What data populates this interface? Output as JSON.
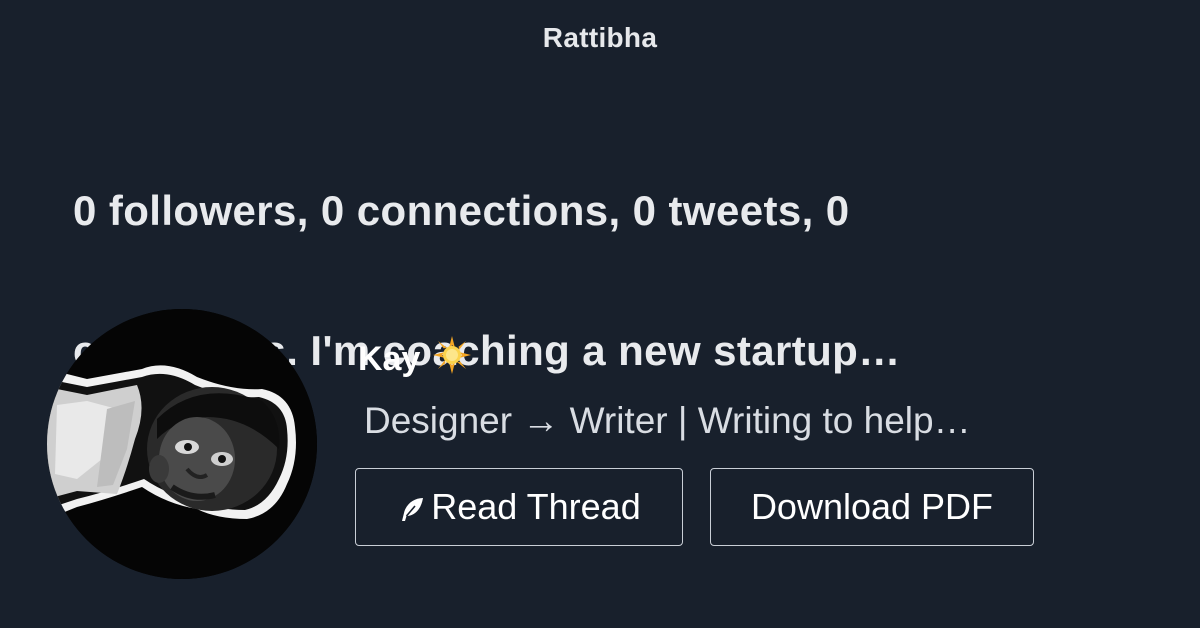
{
  "brand": {
    "name": "Rattibha"
  },
  "thread": {
    "headline_line1": "0 followers, 0 connections, 0 tweets, 0",
    "headline_line2": "comments. I'm coaching a new startup…"
  },
  "author": {
    "name": "Kay",
    "badge_emoji": "🌟",
    "bio": "Designer → Writer | Writing to help…"
  },
  "actions": {
    "read_thread_label": "Read Thread",
    "download_pdf_label": "Download PDF"
  },
  "colors": {
    "background": "#18202c",
    "text": "#e6e8eb",
    "button_border": "#c9ced6"
  },
  "icons": {
    "read_thread": "feather-icon",
    "badge": "glowing-star-emoji"
  }
}
